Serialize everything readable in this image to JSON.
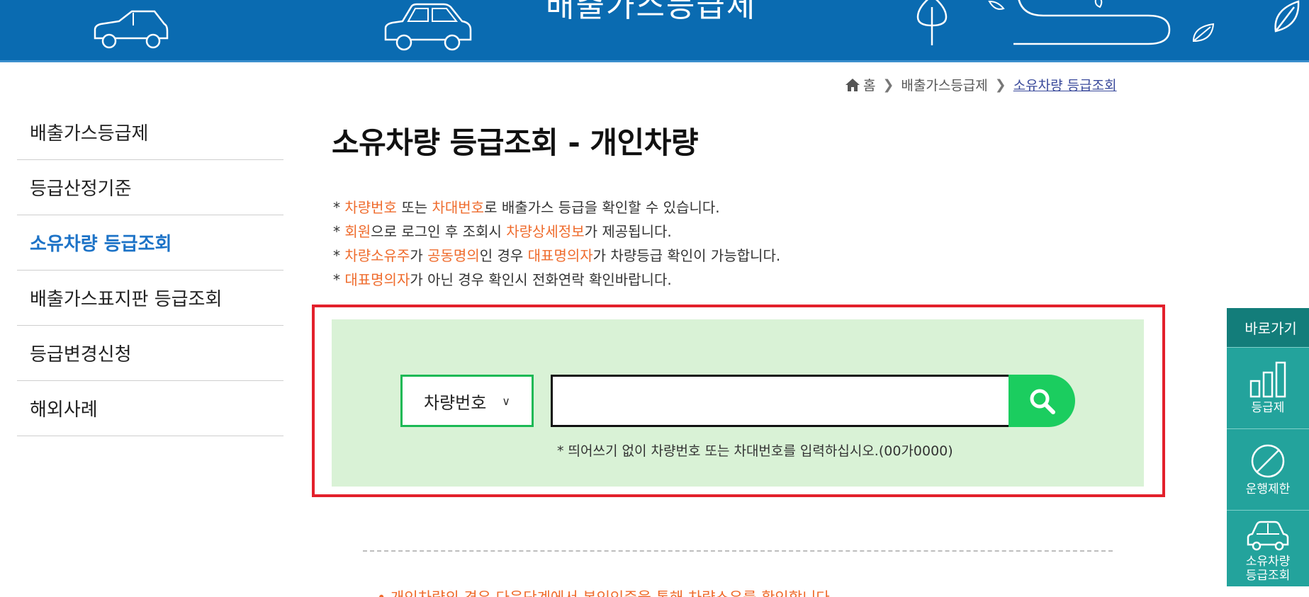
{
  "header": {
    "banner_title": "배출가스등급제"
  },
  "breadcrumb": {
    "home": "홈",
    "level1": "배출가스등급제",
    "current": "소유차량 등급조회"
  },
  "sidebar": {
    "items": [
      {
        "label": "배출가스등급제"
      },
      {
        "label": "등급산정기준"
      },
      {
        "label": "소유차량 등급조회"
      },
      {
        "label": "배출가스표지판 등급조회"
      },
      {
        "label": "등급변경신청"
      },
      {
        "label": "해외사례"
      }
    ]
  },
  "main": {
    "title": "소유차량 등급조회 - 개인차량",
    "notes": [
      {
        "bullet": "*",
        "parts": [
          {
            "t": "차량번호",
            "hl": true
          },
          {
            "t": " 또는 "
          },
          {
            "t": "차대번호",
            "hl": true
          },
          {
            "t": "로 배출가스 등급을 확인할 수 있습니다."
          }
        ]
      },
      {
        "bullet": "*",
        "parts": [
          {
            "t": "회원",
            "hl": true
          },
          {
            "t": "으로 로그인 후 조회시 "
          },
          {
            "t": "차량상세정보",
            "hl": true
          },
          {
            "t": "가 제공됩니다."
          }
        ]
      },
      {
        "bullet": "*",
        "parts": [
          {
            "t": "차량소유주",
            "hl": true
          },
          {
            "t": "가 "
          },
          {
            "t": "공동명의",
            "hl": true
          },
          {
            "t": "인 경우 "
          },
          {
            "t": "대표명의자",
            "hl": true
          },
          {
            "t": "가 차량등급 확인이 가능합니다."
          }
        ]
      },
      {
        "bullet": "*",
        "parts": [
          {
            "t": "대표명의자",
            "hl": true
          },
          {
            "t": "가 아닌 경우 확인시 전화연락 확인바랍니다."
          }
        ]
      }
    ]
  },
  "search": {
    "type_selected": "차량번호",
    "input_value": "",
    "hint": "* 띄어쓰기 없이 차량번호 또는 차대번호를 입력하십시오.(00가0000)"
  },
  "bottom": {
    "note": "• 개인차량의 경우 다음단계에서 본인인증을 통해 차량소유를 확인합니다."
  },
  "quick_menu": {
    "title": "바로가기",
    "items": [
      {
        "label": "등급제",
        "icon": "bar-chart-icon"
      },
      {
        "label": "운행제한",
        "icon": "prohibit-icon"
      },
      {
        "label_line1": "소유차량",
        "label_line2": "등급조회",
        "icon": "car-icon"
      }
    ]
  },
  "colors": {
    "brand_blue": "#0a6bb1",
    "highlight_orange": "#ef6b2c",
    "search_green": "#1bcd5f",
    "quick_teal": "#23a39c",
    "frame_red": "#e3202b",
    "active_blue": "#1d73c7"
  }
}
